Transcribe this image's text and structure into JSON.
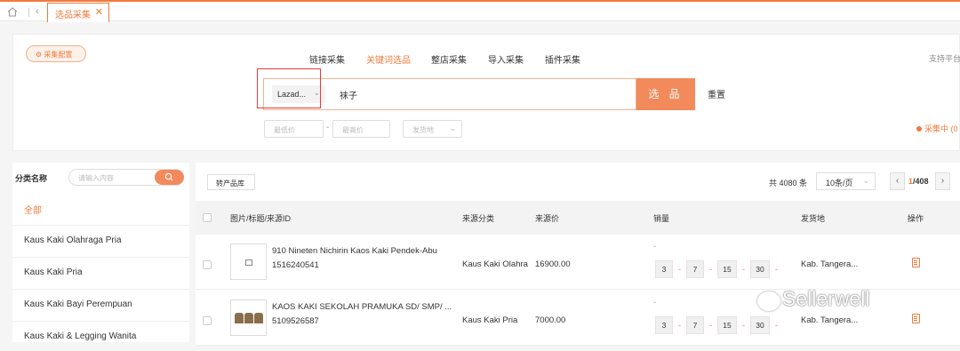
{
  "topbar": {
    "tab_label": "选品采集",
    "tab_close": "✕",
    "back": "‹"
  },
  "config": {
    "label": "⚙ 采集配置"
  },
  "modes": [
    {
      "label": "链接采集",
      "active": false
    },
    {
      "label": "关键词选品",
      "active": true
    },
    {
      "label": "整店采集",
      "active": false
    },
    {
      "label": "导入采集",
      "active": false
    },
    {
      "label": "插件采集",
      "active": false
    }
  ],
  "support_text": "支持平台",
  "search": {
    "platform": "Lazad...",
    "keyword": "袜子",
    "submit": "选 品",
    "reset": "重置"
  },
  "filters": {
    "min_price": "最低价",
    "max_price": "最高价",
    "dash": "-",
    "origin": "发货地"
  },
  "collect_status": "采集中 (0",
  "category": {
    "title": "分类名称",
    "search_placeholder": "请输入内容",
    "all": "全部",
    "items": [
      "Kaus Kaki Olahraga Pria",
      "Kaus Kaki Pria",
      "Kaus Kaki Bayi Perempuan",
      "Kaus Kaki & Legging Wanita"
    ]
  },
  "toolbar": {
    "to_library": "转产品库",
    "total": "共 4080 条",
    "per_page": "10条/页",
    "page_current": "1",
    "page_total": "/408",
    "prev": "‹",
    "next": "›"
  },
  "table": {
    "headers": [
      "图片/标题/来源ID",
      "来源分类",
      "来源价",
      "销量",
      "发货地",
      "操作"
    ],
    "rows": [
      {
        "title": "910 Nineten Nichirin Kaos Kaki Pendek-Abu",
        "source_id": "1516240541",
        "category": "Kaus Kaki Olahra",
        "price": "16900.00",
        "sales_dash": "-",
        "sales": [
          "3",
          "7",
          "15",
          "30"
        ],
        "origin": "Kab. Tangera..."
      },
      {
        "title": "KAOS KAKI SEKOLAH PRAMUKA SD/ SMP/ ...",
        "source_id": "5109526587",
        "category": "Kaus Kaki Pria",
        "price": "7000.00",
        "sales_dash": "-",
        "sales": [
          "3",
          "7",
          "15",
          "30"
        ],
        "origin": "Kab. Tangera..."
      }
    ]
  },
  "watermark": "Sellerwell",
  "colors": {
    "accent": "#f07a3c",
    "highlight_box": "#e23b3b"
  }
}
